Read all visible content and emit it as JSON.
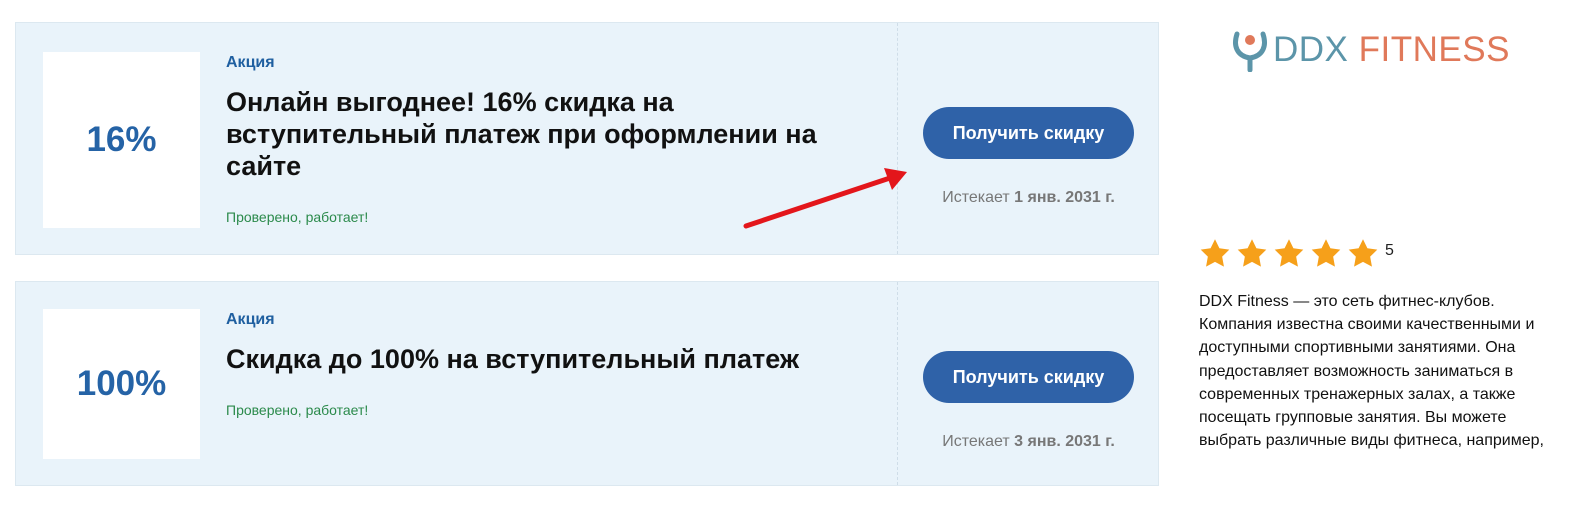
{
  "coupons": [
    {
      "badge": "16%",
      "kind": "Акция",
      "title": "Онлайн выгоднее! 16% скидка на вступительный платеж при оформлении на сайте",
      "verified": "Проверено, работает!",
      "button_label": "Получить скидку",
      "expires_label": "Истекает",
      "expires_date": "1 янв. 2031 г."
    },
    {
      "badge": "100%",
      "kind": "Акция",
      "title": "Скидка до 100% на вступительный платеж",
      "verified": "Проверено, работает!",
      "button_label": "Получить скидку",
      "expires_label": "Истекает",
      "expires_date": "3 янв. 2031 г."
    }
  ],
  "sidebar": {
    "logo": {
      "part1": "DDX",
      "part2": "FITNESS"
    },
    "rating": {
      "value": "5",
      "stars": 5
    },
    "description": "DDX Fitness — это сеть фитнес-клубов. Компания известна своими качественными и доступными спортивными занятиями. Она предоставляет возможность заниматься в современных тренажерных залах, а также посещать групповые занятия. Вы можете выбрать различные виды фитнеса, например,"
  },
  "colors": {
    "card_bg": "#e9f3fa",
    "accent_blue": "#2f62a8",
    "badge_text": "#2563a6",
    "verified_green": "#2b8a4b",
    "arrow_red": "#e3161b",
    "star_orange": "#f6a01a",
    "logo_teal": "#5c95a9",
    "logo_orange": "#e0795a"
  }
}
